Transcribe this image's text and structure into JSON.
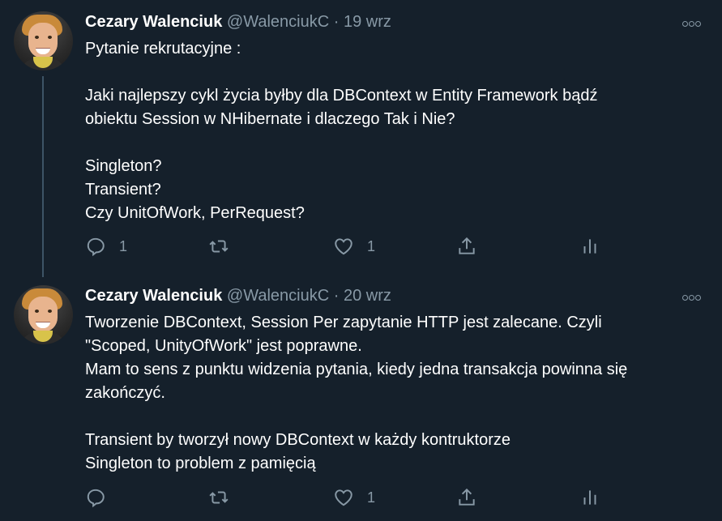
{
  "tweets": [
    {
      "author": "Cezary Walenciuk",
      "handle": "@WalenciukC",
      "separator": "·",
      "date": "19 wrz",
      "text": "Pytanie rekrutacyjne :\n\nJaki najlepszy cykl życia byłby dla DBContext w Entity Framework bądź\nobiektu Session w NHibernate i dlaczego Tak i Nie?\n\nSingleton?\nTransient?\nCzy UnitOfWork, PerRequest?",
      "reply_count": "1",
      "retweet_count": "",
      "like_count": "1"
    },
    {
      "author": "Cezary Walenciuk",
      "handle": "@WalenciukC",
      "separator": "·",
      "date": "20 wrz",
      "text": "Tworzenie DBContext, Session Per zapytanie HTTP jest zalecane. Czyli\n\"Scoped, UnityOfWork\" jest poprawne.\nMam to sens z punktu widzenia pytania, kiedy jedna transakcja powinna się\nzakończyć.\n\nTransient by tworzył nowy DBContext w każdy kontruktorze\nSingleton to problem z pamięcią",
      "reply_count": "",
      "retweet_count": "",
      "like_count": "1"
    }
  ],
  "colors": {
    "background": "#15202b",
    "text": "#ffffff",
    "secondary": "#8899a6",
    "thread_line": "#3d5466"
  },
  "icons": [
    "reply-icon",
    "retweet-icon",
    "like-icon",
    "share-icon",
    "analytics-icon",
    "more-icon"
  ]
}
